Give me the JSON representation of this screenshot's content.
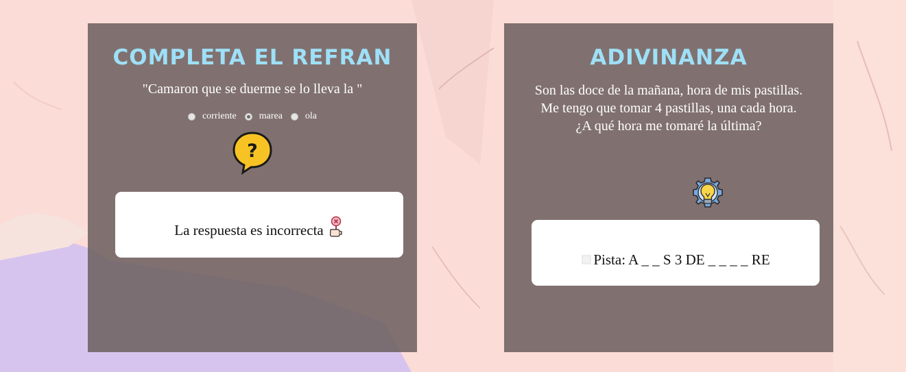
{
  "left_card": {
    "title": "COMPLETA EL REFRAN",
    "quote": "\"Camaron que se duerme se lo lleva la \"",
    "options": [
      {
        "label": "corriente",
        "selected": false
      },
      {
        "label": "marea",
        "selected": true
      },
      {
        "label": "ola",
        "selected": false
      }
    ],
    "icon": "question-bubble-icon",
    "result_text": "La respuesta es incorrecta",
    "result_icon": "wrong-answer-thumb-icon"
  },
  "right_card": {
    "title": "ADIVINANZA",
    "riddle": "Son las doce de la mañana, hora de mis pastillas. Me tengo que tomar 4 pastillas, una cada hora. ¿A qué hora me tomaré la última?",
    "icon": "lightbulb-gear-icon",
    "hint_text": "Pista: A _ _ S 3 DE _ _ _ _ RE"
  },
  "colors": {
    "page_background": "#fbdcd6",
    "card_background": "#6e6262",
    "title": "#9ee0f7",
    "purple_accent": "#d6c3ec"
  }
}
